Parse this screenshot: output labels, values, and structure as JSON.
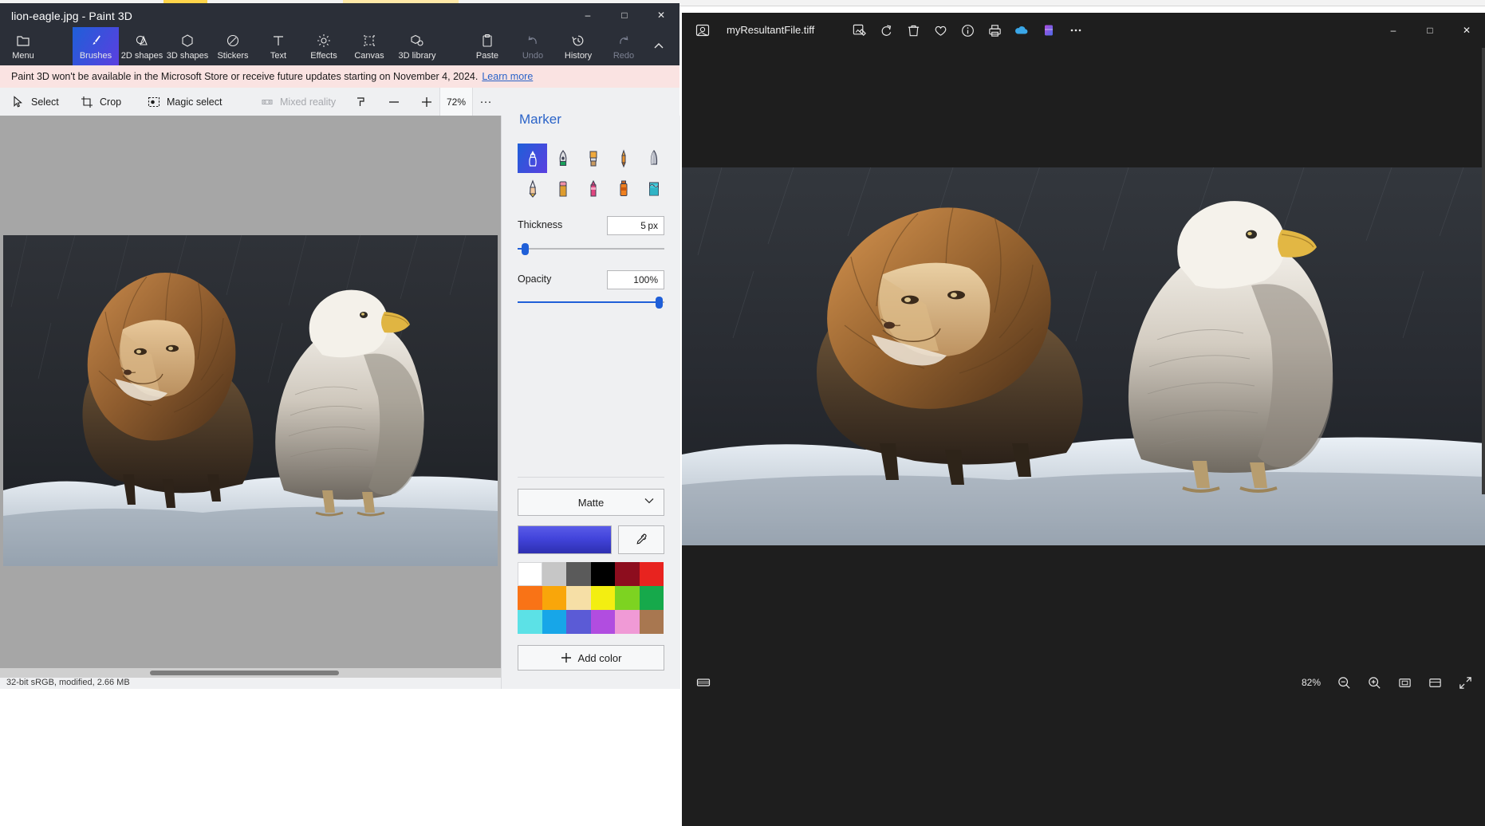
{
  "paint3d": {
    "title": "lion-eagle.jpg - Paint 3D",
    "window_buttons": [
      {
        "name": "minimize",
        "glyph": "–"
      },
      {
        "name": "maximize",
        "glyph": "□"
      },
      {
        "name": "close",
        "glyph": "✕"
      }
    ],
    "ribbon": [
      {
        "label": "Menu",
        "icon": "folder-icon",
        "state": "normal"
      },
      {
        "label": "Brushes",
        "icon": "brush-icon",
        "state": "active"
      },
      {
        "label": "2D shapes",
        "icon": "2d-shapes-icon",
        "state": "normal"
      },
      {
        "label": "3D shapes",
        "icon": "3d-shapes-icon",
        "state": "normal"
      },
      {
        "label": "Stickers",
        "icon": "stickers-icon",
        "state": "normal"
      },
      {
        "label": "Text",
        "icon": "text-icon",
        "state": "normal"
      },
      {
        "label": "Effects",
        "icon": "effects-icon",
        "state": "normal"
      },
      {
        "label": "Canvas",
        "icon": "canvas-icon",
        "state": "normal"
      },
      {
        "label": "3D library",
        "icon": "3d-library-icon",
        "state": "normal"
      },
      {
        "label": "Paste",
        "icon": "paste-icon",
        "state": "normal"
      },
      {
        "label": "Undo",
        "icon": "undo-icon",
        "state": "disabled"
      },
      {
        "label": "History",
        "icon": "history-icon",
        "state": "normal"
      },
      {
        "label": "Redo",
        "icon": "redo-icon",
        "state": "disabled"
      }
    ],
    "notice": {
      "text": "Paint 3D won't be available in the Microsoft Store or receive future updates starting on November 4, 2024.",
      "link": "Learn more"
    },
    "tools": [
      {
        "label": "Select",
        "icon": "select-cursor-icon",
        "state": "normal"
      },
      {
        "label": "Crop",
        "icon": "crop-icon",
        "state": "normal"
      },
      {
        "label": "Magic select",
        "icon": "magic-select-icon",
        "state": "normal"
      },
      {
        "label": "Mixed reality",
        "icon": "mixed-reality-icon",
        "state": "disabled"
      }
    ],
    "zoom_value": "72%",
    "more_glyph": "···",
    "status_text": "32-bit sRGB, modified, 2.66 MB",
    "panel": {
      "title": "Marker",
      "brushes": [
        {
          "name": "marker",
          "selected": true
        },
        {
          "name": "calligraphy-pen",
          "selected": false
        },
        {
          "name": "oil-brush",
          "selected": false
        },
        {
          "name": "watercolor-brush",
          "selected": false
        },
        {
          "name": "pixel-pen",
          "selected": false
        },
        {
          "name": "pencil",
          "selected": false
        },
        {
          "name": "eraser",
          "selected": false
        },
        {
          "name": "crayon",
          "selected": false
        },
        {
          "name": "spray-can",
          "selected": false
        },
        {
          "name": "fill-bucket",
          "selected": false
        }
      ],
      "thickness": {
        "label": "Thickness",
        "value": "5 px",
        "percent": 5
      },
      "opacity": {
        "label": "Opacity",
        "value": "100%",
        "percent": 100
      },
      "material": {
        "selected": "Matte",
        "chevron": "⌄"
      },
      "current_color": "#3d3fd4",
      "eyedropper_icon": "eyedropper-icon",
      "swatches": [
        "#ffffff",
        "#c6c6c6",
        "#5a5a5a",
        "#000000",
        "#8d0d1e",
        "#e8231f",
        "#f97316",
        "#f9a60a",
        "#f6dfa6",
        "#f3ee11",
        "#7dd321",
        "#16a94b",
        "#5ce1e6",
        "#17a6e8",
        "#5b5bd6",
        "#b14de0",
        "#f09ad6",
        "#a87750"
      ],
      "add_color": {
        "label": "Add color",
        "icon": "plus-icon"
      }
    }
  },
  "photos": {
    "filename": "myResultantFile.tiff",
    "app_icon": "photos-app-icon",
    "commands": [
      {
        "name": "edit-image-icon"
      },
      {
        "name": "rotate-icon"
      },
      {
        "name": "delete-icon"
      },
      {
        "name": "favorite-heart-icon"
      },
      {
        "name": "info-icon"
      },
      {
        "name": "print-icon"
      },
      {
        "name": "onedrive-icon"
      },
      {
        "name": "designer-icon"
      },
      {
        "name": "more-options-icon"
      }
    ],
    "window_buttons": [
      {
        "name": "minimize",
        "glyph": "–"
      },
      {
        "name": "maximize",
        "glyph": "□"
      },
      {
        "name": "close",
        "glyph": "✕"
      }
    ],
    "bottom": {
      "filmstrip_icon": "filmstrip-icon",
      "zoom_value": "82%",
      "zoom_out_icon": "zoom-out-icon",
      "zoom_in_icon": "zoom-in-icon",
      "fit-to-window_icon": "fit-to-window-icon",
      "actual-size_icon": "actual-size-icon",
      "fullscreen_icon": "fullscreen-icon"
    }
  },
  "artwork": {
    "description": "lion and eagle standing on snowy rocks in rain",
    "sky": "#2a2d33",
    "ground": "#aeb6c0"
  }
}
